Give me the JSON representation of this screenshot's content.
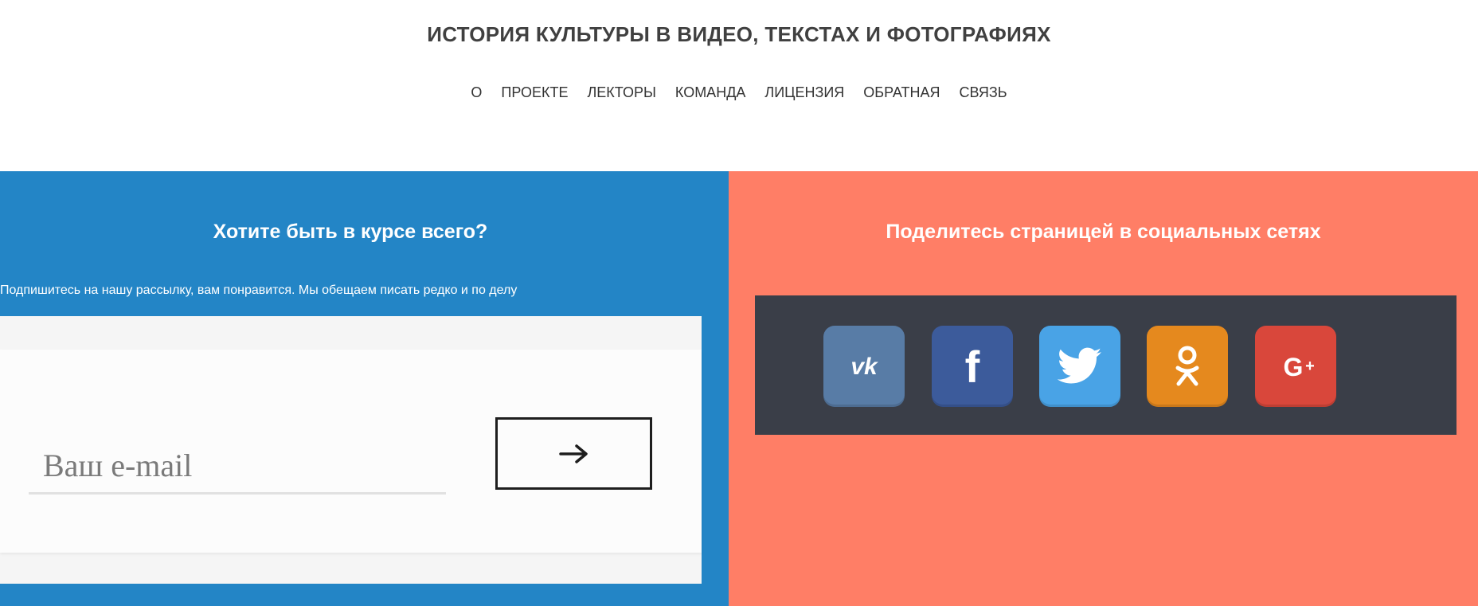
{
  "header": {
    "title": "ИСТОРИЯ КУЛЬТУРЫ В ВИДЕО, ТЕКСТАХ И ФОТОГРАФИЯХ",
    "nav": [
      "О",
      "ПРОЕКТЕ",
      "ЛЕКТОРЫ",
      "КОМАНДА",
      "ЛИЦЕНЗИЯ",
      "ОБРАТНАЯ",
      "СВЯЗЬ"
    ]
  },
  "subscribe": {
    "heading": "Хотите быть в курсе всего?",
    "description": "Подпишитесь на нашу рассылку, вам понравится. Мы обещаем писать редко и по делу",
    "email_placeholder": "Ваш e-mail",
    "email_value": "",
    "submit_icon": "arrow-right-icon"
  },
  "share": {
    "heading": "Поделитесь страницей в социальных сетях",
    "networks": [
      {
        "name": "VK",
        "icon": "vk-icon",
        "color": "#587ca6"
      },
      {
        "name": "Facebook",
        "icon": "facebook-icon",
        "color": "#3c5b9b"
      },
      {
        "name": "Twitter",
        "icon": "twitter-icon",
        "color": "#49a3e6"
      },
      {
        "name": "Odnoklassniki",
        "icon": "odnoklassniki-icon",
        "color": "#e5891e"
      },
      {
        "name": "Google+",
        "icon": "google-plus-icon",
        "color": "#d9473b"
      }
    ]
  },
  "colors": {
    "subscribe_bg": "#2385c6",
    "share_bg": "#ff7e66",
    "share_box_bg": "#3a3e48"
  }
}
